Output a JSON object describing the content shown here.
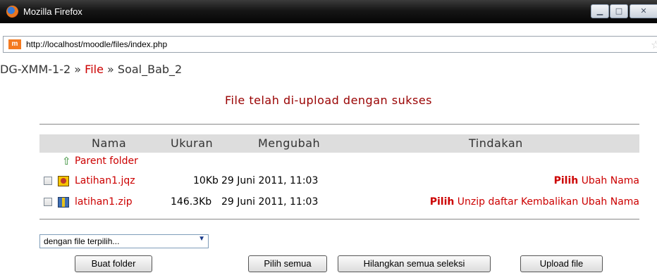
{
  "window": {
    "title": "Mozilla Firefox",
    "minimize_glyph": "▁",
    "maximize_glyph": "□",
    "close_glyph": "✕"
  },
  "address_bar": {
    "site_icon_text": "m",
    "url": "http://localhost/moodle/files/index.php",
    "star_icon": "☆"
  },
  "breadcrumb": {
    "course": "DG-XMM-1-2",
    "sep1": "»",
    "files_link": "File",
    "sep2": "»",
    "current": "Soal_Bab_2"
  },
  "notice": "File telah di-upload dengan sukses",
  "table": {
    "headers": {
      "name": "Nama",
      "size": "Ukuran",
      "modified": "Mengubah",
      "actions": "Tindakan"
    },
    "parent_folder": {
      "icon": "⇧",
      "label": "Parent folder"
    },
    "rows": [
      {
        "name": "Latihan1.jqz",
        "size": "10Kb",
        "modified": "29 Juni 2011, 11:03",
        "actions": {
          "choose": "Pilih",
          "rename": "Ubah Nama"
        }
      },
      {
        "name": "latihan1.zip",
        "size": "146.3Kb",
        "modified": "29 Juni 2011, 11:03",
        "actions": {
          "choose": "Pilih",
          "unzip": "Unzip",
          "list": "daftar",
          "restore": "Kembalikan",
          "rename": "Ubah Nama"
        }
      }
    ]
  },
  "controls": {
    "with_selected": {
      "selected": "dengan file terpilih...",
      "arrow": "▼"
    },
    "make_folder": "Buat folder",
    "select_all": "Pilih semua",
    "deselect_all": "Hilangkan semua seleksi",
    "upload": "Upload file"
  },
  "colors": {
    "link": "#cc0000",
    "header_bg": "#dddddd",
    "notice": "#990000"
  }
}
